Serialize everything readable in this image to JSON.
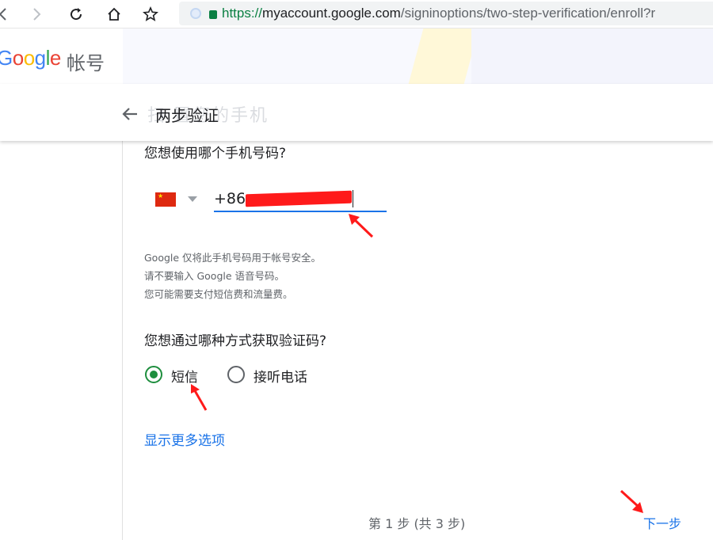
{
  "browser": {
    "url_scheme": "https://",
    "url_host": "myaccount.google.com",
    "url_path": "/signinoptions/two-step-verification/enroll?r"
  },
  "header": {
    "brand_letters": [
      "G",
      "o",
      "o",
      "g",
      "l",
      "e"
    ],
    "brand_suffix": "帐号"
  },
  "page": {
    "title": "两步验证",
    "ghost_title": "扫 置您的手机"
  },
  "phone": {
    "question": "您想使用哪个手机号码?",
    "country_code": "+86",
    "hint_lines": [
      "Google 仅将此手机号码用于帐号安全。",
      "请不要输入 Google 语音号码。",
      "您可能需要支付短信费和流量费。"
    ]
  },
  "method": {
    "question": "您想通过哪种方式获取验证码?",
    "options": [
      {
        "label": "短信",
        "selected": true
      },
      {
        "label": "接听电话",
        "selected": false
      }
    ]
  },
  "more_options_label": "显示更多选项",
  "footer": {
    "step_text": "第 1 步 (共 3 步)",
    "next_label": "下一步"
  },
  "colors": {
    "accent": "#1a73e8",
    "radio_selected": "#1e8e3e",
    "annotation": "#ff1a1a"
  }
}
